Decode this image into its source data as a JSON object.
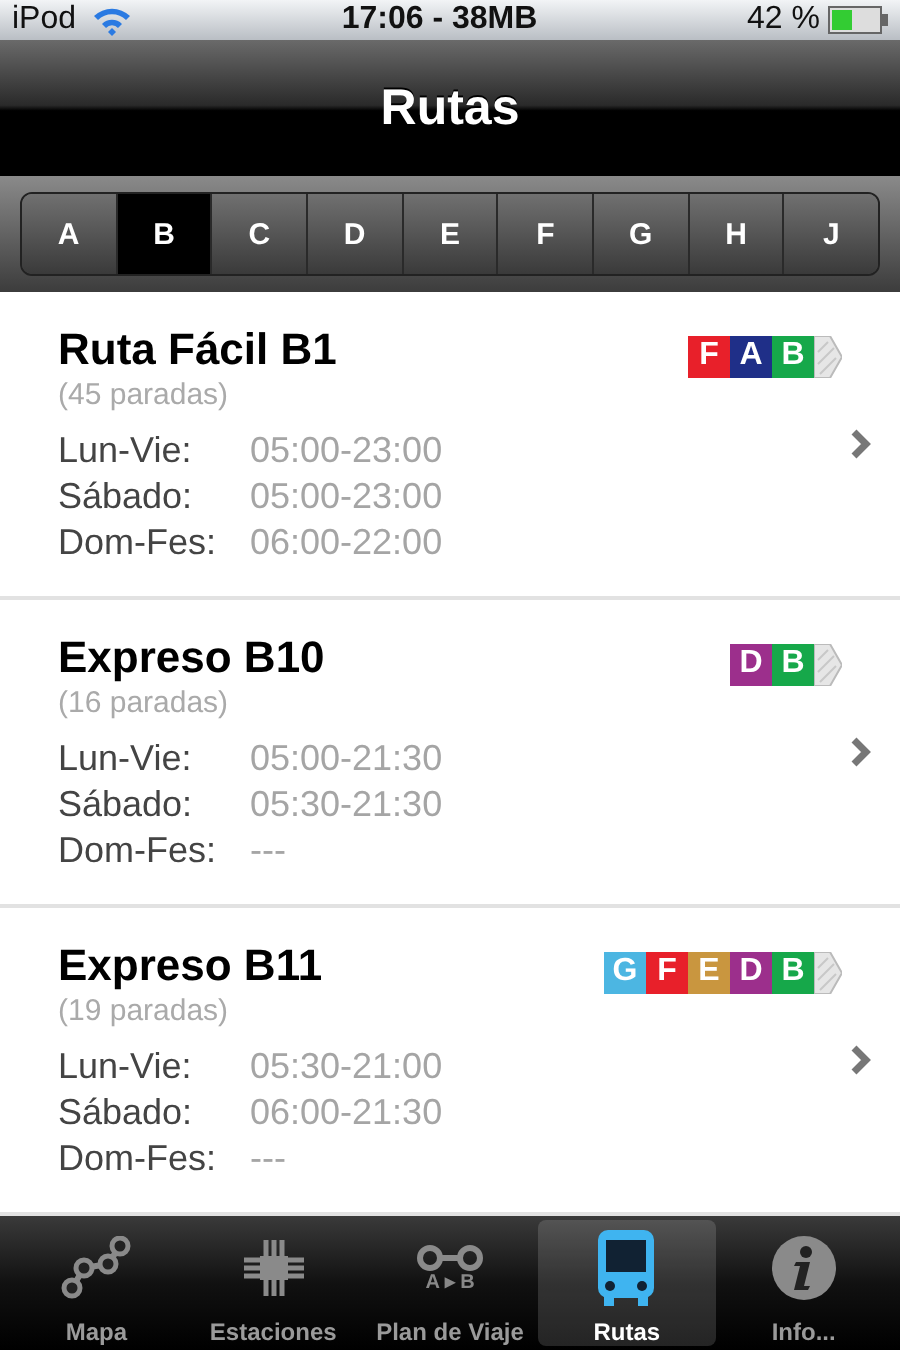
{
  "status_bar": {
    "device": "iPod",
    "time": "17:06 - 38MB",
    "battery": "42 %"
  },
  "nav": {
    "title": "Rutas"
  },
  "letters": [
    {
      "label": "A",
      "selected": false
    },
    {
      "label": "B",
      "selected": true
    },
    {
      "label": "C",
      "selected": false
    },
    {
      "label": "D",
      "selected": false
    },
    {
      "label": "E",
      "selected": false
    },
    {
      "label": "F",
      "selected": false
    },
    {
      "label": "G",
      "selected": false
    },
    {
      "label": "H",
      "selected": false
    },
    {
      "label": "J",
      "selected": false
    }
  ],
  "routes": [
    {
      "name": "Ruta Fácil B1",
      "stops": "(45 paradas)",
      "badges": [
        {
          "label": "F",
          "color": "#e8202a"
        },
        {
          "label": "A",
          "color": "#1f2f88"
        },
        {
          "label": "B",
          "color": "#16a84a"
        }
      ],
      "schedule": [
        {
          "day": "Lun-Vie:",
          "hours": "05:00-23:00"
        },
        {
          "day": "Sábado:",
          "hours": "05:00-23:00"
        },
        {
          "day": "Dom-Fes:",
          "hours": "06:00-22:00"
        }
      ]
    },
    {
      "name": "Expreso B10",
      "stops": "(16 paradas)",
      "badges": [
        {
          "label": "D",
          "color": "#9c2f8c"
        },
        {
          "label": "B",
          "color": "#16a84a"
        }
      ],
      "schedule": [
        {
          "day": "Lun-Vie:",
          "hours": "05:00-21:30"
        },
        {
          "day": "Sábado:",
          "hours": "05:30-21:30"
        },
        {
          "day": "Dom-Fes:",
          "hours": "---"
        }
      ]
    },
    {
      "name": "Expreso B11",
      "stops": "(19 paradas)",
      "badges": [
        {
          "label": "G",
          "color": "#4cb6e2"
        },
        {
          "label": "F",
          "color": "#e8202a"
        },
        {
          "label": "E",
          "color": "#c9963f"
        },
        {
          "label": "D",
          "color": "#9c2f8c"
        },
        {
          "label": "B",
          "color": "#16a84a"
        }
      ],
      "schedule": [
        {
          "day": "Lun-Vie:",
          "hours": "05:30-21:00"
        },
        {
          "day": "Sábado:",
          "hours": "06:00-21:30"
        },
        {
          "day": "Dom-Fes:",
          "hours": "---"
        }
      ]
    }
  ],
  "tab_bar": [
    {
      "kind": "map",
      "label": "Mapa",
      "selected": false
    },
    {
      "kind": "stations",
      "label": "Estaciones",
      "selected": false
    },
    {
      "kind": "plan",
      "label": "Plan de Viaje",
      "icon_text": "A ▸ B",
      "selected": false
    },
    {
      "kind": "routes",
      "label": "Rutas",
      "selected": true
    },
    {
      "kind": "info",
      "label": "Info...",
      "selected": false
    }
  ]
}
